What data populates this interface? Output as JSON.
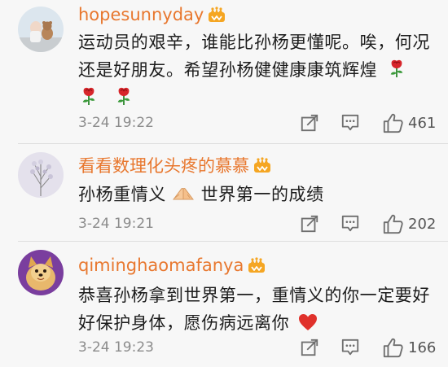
{
  "comments": [
    {
      "user": "hopesunnyday",
      "text": "运动员的艰辛，谁能比孙杨更懂呢。唉，何况还是好朋友。希望孙杨健健康康筑辉煌",
      "time": "3-24 19:22",
      "likes": "461"
    },
    {
      "user": "看看数理化头疼的慕慕",
      "text_before": "孙杨重情义",
      "text_after": "世界第一的成绩",
      "time": "3-24 19:21",
      "likes": "202"
    },
    {
      "user": "qiminghaomafanya",
      "text": "恭喜孙杨拿到世界第一，重情义的你一定要好好保护身体，愿伤病远离你",
      "time": "3-24 19:23",
      "likes": "166"
    }
  ],
  "icons": {
    "verified_badge": "crown-badge-icon",
    "share": "share-icon",
    "reply": "comment-icon",
    "like": "thumb-up-icon"
  },
  "colors": {
    "username": "#e8772e",
    "text": "#1c1c1c",
    "meta": "#8c8c8c",
    "badge": "#f5a623",
    "rose": "#d7262b",
    "heart": "#e0312b"
  }
}
